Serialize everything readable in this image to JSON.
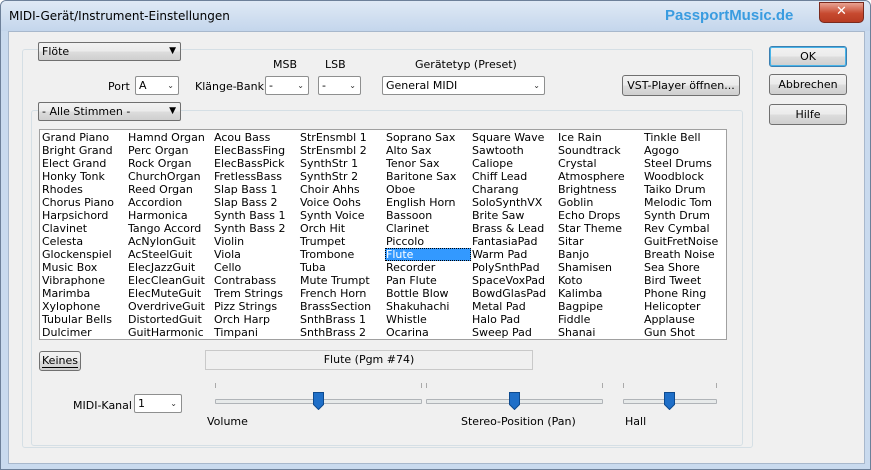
{
  "window": {
    "title": "MIDI-Gerät/Instrument-Einstellungen",
    "brand": "PassportMusic.de",
    "close_glyph": "✕"
  },
  "device": {
    "selected": "Flöte",
    "port_label": "Port",
    "port_value": "A",
    "bank_label": "Klänge-Bank",
    "msb_label": "MSB",
    "msb_value": "-",
    "lsb_label": "LSB",
    "lsb_value": "-",
    "preset_label": "Gerätetyp (Preset)",
    "preset_value": "General MIDI",
    "vst_button": "VST-Player öffnen..."
  },
  "voices": {
    "filter": "- Alle Stimmen -",
    "selected": "Flute",
    "columns": [
      [
        "Grand Piano",
        "Bright Grand",
        "Elect Grand",
        "Honky Tonk",
        "Rhodes",
        "Chorus Piano",
        "Harpsichord",
        "Clavinet",
        "Celesta",
        "Glockenspiel",
        "Music Box",
        "Vibraphone",
        "Marimba",
        "Xylophone",
        "Tubular Bells",
        "Dulcimer"
      ],
      [
        "Hamnd Organ",
        "Perc Organ",
        "Rock Organ",
        "ChurchOrgan",
        "Reed Organ",
        "Accordion",
        "Harmonica",
        "Tango Accord",
        "AcNylonGuit",
        "AcSteelGuit",
        "ElecJazzGuit",
        "ElecCleanGuit",
        "ElecMuteGuit",
        "OverdriveGuit",
        "DistortedGuit",
        "GuitHarmonic"
      ],
      [
        "Acou Bass",
        "ElecBassFing",
        "ElecBassPick",
        "FretlessBass",
        "Slap Bass 1",
        "Slap Bass 2",
        "Synth Bass 1",
        "Synth Bass 2",
        "Violin",
        "Viola",
        "Cello",
        "Contrabass",
        "Trem Strings",
        "Pizz Strings",
        "Orch Harp",
        "Timpani"
      ],
      [
        "StrEnsmbl 1",
        "StrEnsmbl 2",
        "SynthStr 1",
        "SynthStr 2",
        "Choir Ahhs",
        "Voice Oohs",
        "Synth Voice",
        "Orch Hit",
        "Trumpet",
        "Trombone",
        "Tuba",
        "Mute Trumpt",
        "French Horn",
        "BrassSection",
        "SnthBrass 1",
        "SnthBrass 2"
      ],
      [
        "Soprano Sax",
        "Alto Sax",
        "Tenor Sax",
        "Baritone Sax",
        "Oboe",
        "English Horn",
        "Bassoon",
        "Clarinet",
        "Piccolo",
        "Flute",
        "Recorder",
        "Pan Flute",
        "Bottle Blow",
        "Shakuhachi",
        "Whistle",
        "Ocarina"
      ],
      [
        "Square Wave",
        "Sawtooth",
        "Caliope",
        "Chiff Lead",
        "Charang",
        "SoloSynthVX",
        "Brite Saw",
        "Brass & Lead",
        "FantasiaPad",
        "Warm Pad",
        "PolySnthPad",
        "SpaceVoxPad",
        "BowdGlasPad",
        "Metal Pad",
        "Halo Pad",
        "Sweep Pad"
      ],
      [
        "Ice Rain",
        "Soundtrack",
        "Crystal",
        "Atmosphere",
        "Brightness",
        "Goblin",
        "Echo Drops",
        "Star Theme",
        "Sitar",
        "Banjo",
        "Shamisen",
        "Koto",
        "Kalimba",
        "Bagpipe",
        "Fiddle",
        "Shanai"
      ],
      [
        "Tinkle Bell",
        "Agogo",
        "Steel Drums",
        "Woodblock",
        "Taiko Drum",
        "Melodic Tom",
        "Synth Drum",
        "Rev Cymbal",
        "GuitFretNoise",
        "Breath Noise",
        "Sea Shore",
        "Bird Tweet",
        "Phone Ring",
        "Helicopter",
        "Applause",
        "Gun Shot"
      ]
    ],
    "none_button": "Keines",
    "status": "Flute (Pgm #74)"
  },
  "mixer": {
    "channel_label": "MIDI-Kanal",
    "channel_value": "1",
    "volume_label": "Volume",
    "volume_level": 0.5,
    "pan_label": "Stereo-Position (Pan)",
    "pan_level": 0.5,
    "hall_label": "Hall",
    "hall_level": 0.5
  },
  "actions": {
    "ok": "OK",
    "cancel": "Abbrechen",
    "help": "Hilfe"
  },
  "colors": {
    "selection": "#3399ff",
    "brand": "#3a9ce0",
    "slider_thumb": "#1f6fc8",
    "close_button": "#c74a30"
  }
}
